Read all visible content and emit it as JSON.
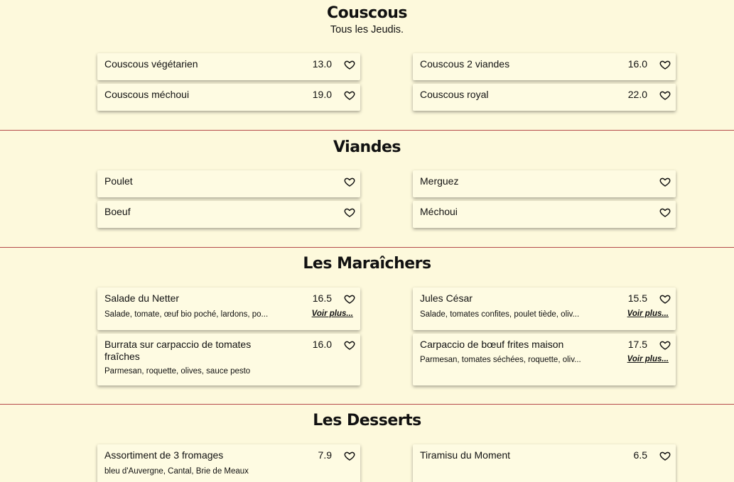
{
  "sections": [
    {
      "title": "Couscous",
      "subtitle": "Tous les Jeudis.",
      "items": [
        {
          "name": "Couscous végétarien",
          "price": "13.0"
        },
        {
          "name": "Couscous 2 viandes",
          "price": "16.0"
        },
        {
          "name": "Couscous méchoui",
          "price": "19.0"
        },
        {
          "name": "Couscous royal",
          "price": "22.0"
        }
      ]
    },
    {
      "title": "Viandes",
      "items": [
        {
          "name": "Poulet"
        },
        {
          "name": "Merguez"
        },
        {
          "name": "Boeuf"
        },
        {
          "name": "Méchoui"
        }
      ]
    },
    {
      "title": "Les Maraîchers",
      "items": [
        {
          "name": "Salade du Netter",
          "price": "16.5",
          "desc": "Salade, tomate, œuf bio poché, lardons, po...",
          "more": "Voir plus..."
        },
        {
          "name": "Jules César",
          "price": "15.5",
          "desc": "Salade, tomates confites, poulet tiède, oliv...",
          "more": "Voir plus..."
        },
        {
          "name": "Burrata sur carpaccio de tomates fraîches",
          "price": "16.0",
          "desc": "Parmesan, roquette, olives, sauce pesto"
        },
        {
          "name": "Carpaccio de bœuf frites maison",
          "price": "17.5",
          "desc": "Parmesan, tomates séchées, roquette, oliv...",
          "more": "Voir plus..."
        }
      ]
    },
    {
      "title": "Les Desserts",
      "items": [
        {
          "name": "Assortiment de 3 fromages",
          "price": "7.9",
          "desc": "bleu d'Auvergne, Cantal, Brie de Meaux"
        },
        {
          "name": "Tiramisu du Moment",
          "price": "6.5"
        }
      ]
    }
  ],
  "icons": {
    "favorite": "heart-outline-icon"
  },
  "colors": {
    "background": "#fdf9dc",
    "card": "#fefbe2",
    "divider": "#b54a4a"
  }
}
